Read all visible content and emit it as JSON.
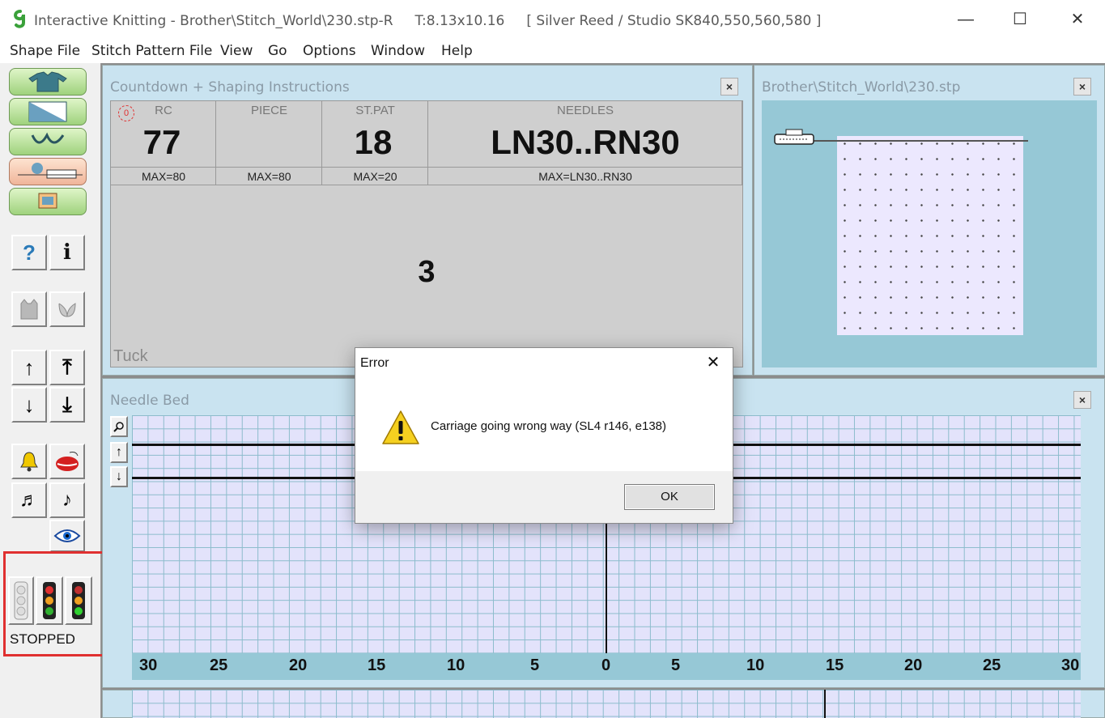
{
  "window": {
    "title": "Interactive Knitting - Brother\\Stitch_World\\230.stp-R     T:8.13x10.16     [ Silver Reed / Studio SK840,550,560,580 ]",
    "minimize": "—",
    "maximize": "☐",
    "close": "✕"
  },
  "menu": [
    "Shape File",
    "Stitch Pattern File",
    "View",
    "Go",
    "Options",
    "Window",
    "Help"
  ],
  "toolbar": {
    "status": "STOPPED",
    "help_glyph": "?",
    "info_glyph": "i",
    "up_glyph": "↑",
    "top_glyph": "⤒",
    "down_glyph": "↓",
    "bottom_glyph": "⤓",
    "bell_glyph": "🔔",
    "music1_glyph": "♬",
    "music2_glyph": "♪"
  },
  "countdown": {
    "title": "Countdown + Shaping Instructions",
    "close": "×",
    "rc_label": "RC",
    "rc_value": "77",
    "rc_max": "MAX=80",
    "piece_label": "PIECE",
    "piece_value": "",
    "piece_max": "MAX=80",
    "stpat_label": "ST.PAT",
    "stpat_value": "18",
    "stpat_max": "MAX=20",
    "needles_label": "NEEDLES",
    "needles_value": "LN30..RN30",
    "needles_max": "MAX=LN30..RN30",
    "big_number": "3",
    "mode": "Tuck",
    "counter_badge": "0"
  },
  "preview": {
    "title": "Brother\\Stitch_World\\230.stp",
    "close": "×"
  },
  "needlebed": {
    "title": "Needle Bed",
    "close": "×",
    "numbers": [
      "30",
      "25",
      "20",
      "15",
      "10",
      "5",
      "0",
      "5",
      "10",
      "15",
      "20",
      "25",
      "30"
    ]
  },
  "dialog": {
    "title": "Error",
    "close": "✕",
    "message": "Carriage going wrong way (SL4 r146, e138)",
    "ok": "OK"
  },
  "colors": {
    "panel_bg": "#c9e3f0",
    "grid_bg": "#e3e3fb",
    "highlight": "#e03030"
  }
}
